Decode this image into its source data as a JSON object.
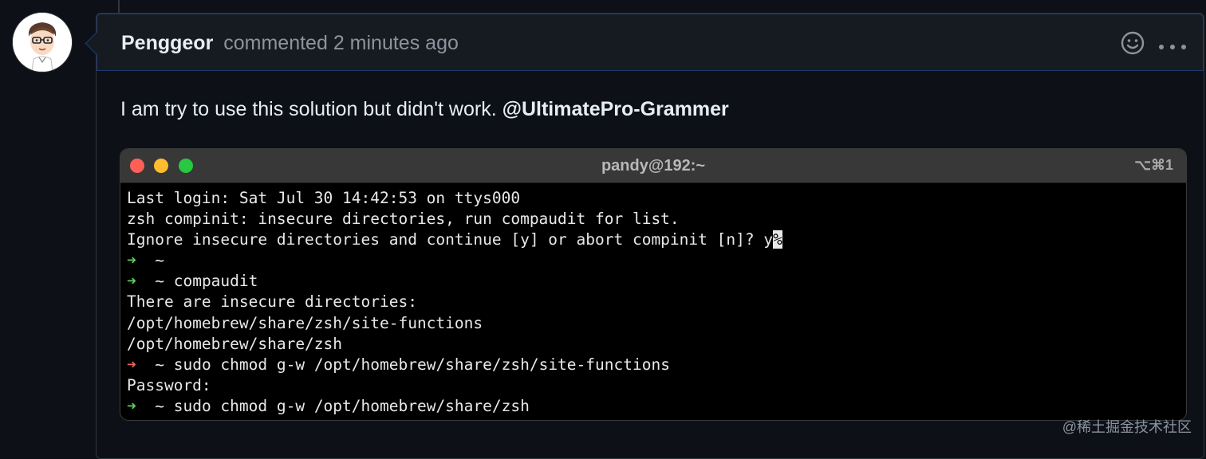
{
  "comment": {
    "author": "Penggeor",
    "action": "commented",
    "time": "2 minutes ago",
    "body_text": "I am try to use this solution but didn't work. ",
    "mention": "@UltimatePro-Grammer"
  },
  "terminal": {
    "title": "pandy@192:~",
    "shortcut": "⌥⌘1",
    "lines": [
      {
        "type": "output",
        "text": "Last login: Sat Jul 30 14:42:53 on ttys000"
      },
      {
        "type": "output",
        "text": "zsh compinit: insecure directories, run compaudit for list."
      },
      {
        "type": "output",
        "text": "Ignore insecure directories and continue [y] or abort compinit [n]? y",
        "cursor": "%"
      },
      {
        "type": "prompt",
        "status": "ok",
        "cmd": ""
      },
      {
        "type": "prompt",
        "status": "ok",
        "cmd": "compaudit"
      },
      {
        "type": "output",
        "text": "There are insecure directories:"
      },
      {
        "type": "output",
        "text": "/opt/homebrew/share/zsh/site-functions"
      },
      {
        "type": "output",
        "text": "/opt/homebrew/share/zsh"
      },
      {
        "type": "prompt",
        "status": "err",
        "cmd": "sudo chmod g-w /opt/homebrew/share/zsh/site-functions"
      },
      {
        "type": "output",
        "text": "Password:"
      },
      {
        "type": "prompt",
        "status": "ok",
        "cmd": "sudo chmod g-w /opt/homebrew/share/zsh"
      }
    ],
    "prompt_arrow": "➜",
    "prompt_dir": "~"
  },
  "watermark": "@稀土掘金技术社区",
  "colors": {
    "accent_border": "#1f3a6b",
    "arrow_ok": "#5ccf5c",
    "arrow_err": "#e8645a"
  }
}
